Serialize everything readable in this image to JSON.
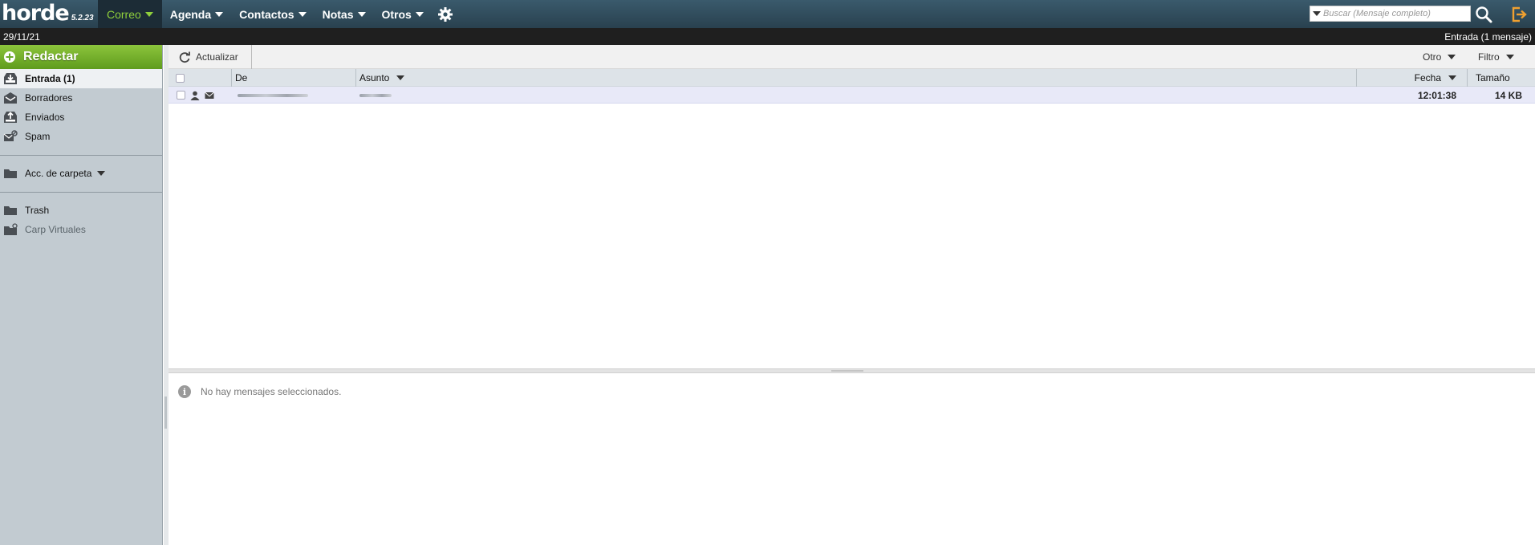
{
  "app": {
    "logo": "horde",
    "version": "5.2.23"
  },
  "nav": {
    "items": [
      {
        "label": "Correo",
        "active": true
      },
      {
        "label": "Agenda"
      },
      {
        "label": "Contactos"
      },
      {
        "label": "Notas"
      },
      {
        "label": "Otros"
      }
    ],
    "settings_icon": "gear-icon"
  },
  "search": {
    "placeholder": "Buscar (Mensaje completo)"
  },
  "status": {
    "date": "29/11/21",
    "folder_info": "Entrada (1 mensaje)"
  },
  "sidebar": {
    "compose_label": "Redactar",
    "folders": [
      {
        "label": "Entrada (1)",
        "icon": "inbox-icon",
        "active": true
      },
      {
        "label": "Borradores",
        "icon": "drafts-icon"
      },
      {
        "label": "Enviados",
        "icon": "sent-icon"
      },
      {
        "label": "Spam",
        "icon": "spam-icon"
      }
    ],
    "folder_actions_label": "Acc. de carpeta",
    "extra_folders": [
      {
        "label": "Trash",
        "icon": "folder-icon"
      },
      {
        "label": "Carp Virtuales",
        "icon": "virtual-folder-icon"
      }
    ]
  },
  "toolbar": {
    "refresh_label": "Actualizar",
    "other_label": "Otro",
    "filter_label": "Filtro"
  },
  "columns": {
    "from": "De",
    "subject": "Asunto",
    "date": "Fecha",
    "size": "Tamaño"
  },
  "messages": [
    {
      "from": "",
      "subject": "",
      "time": "12:01:38",
      "size": "14 KB",
      "unread": true
    }
  ],
  "preview": {
    "empty_text": "No hay mensajes seleccionados."
  },
  "colors": {
    "accent": "#8fcf3c",
    "compose": "#6fae2a",
    "topbar": "#2f4a59"
  }
}
